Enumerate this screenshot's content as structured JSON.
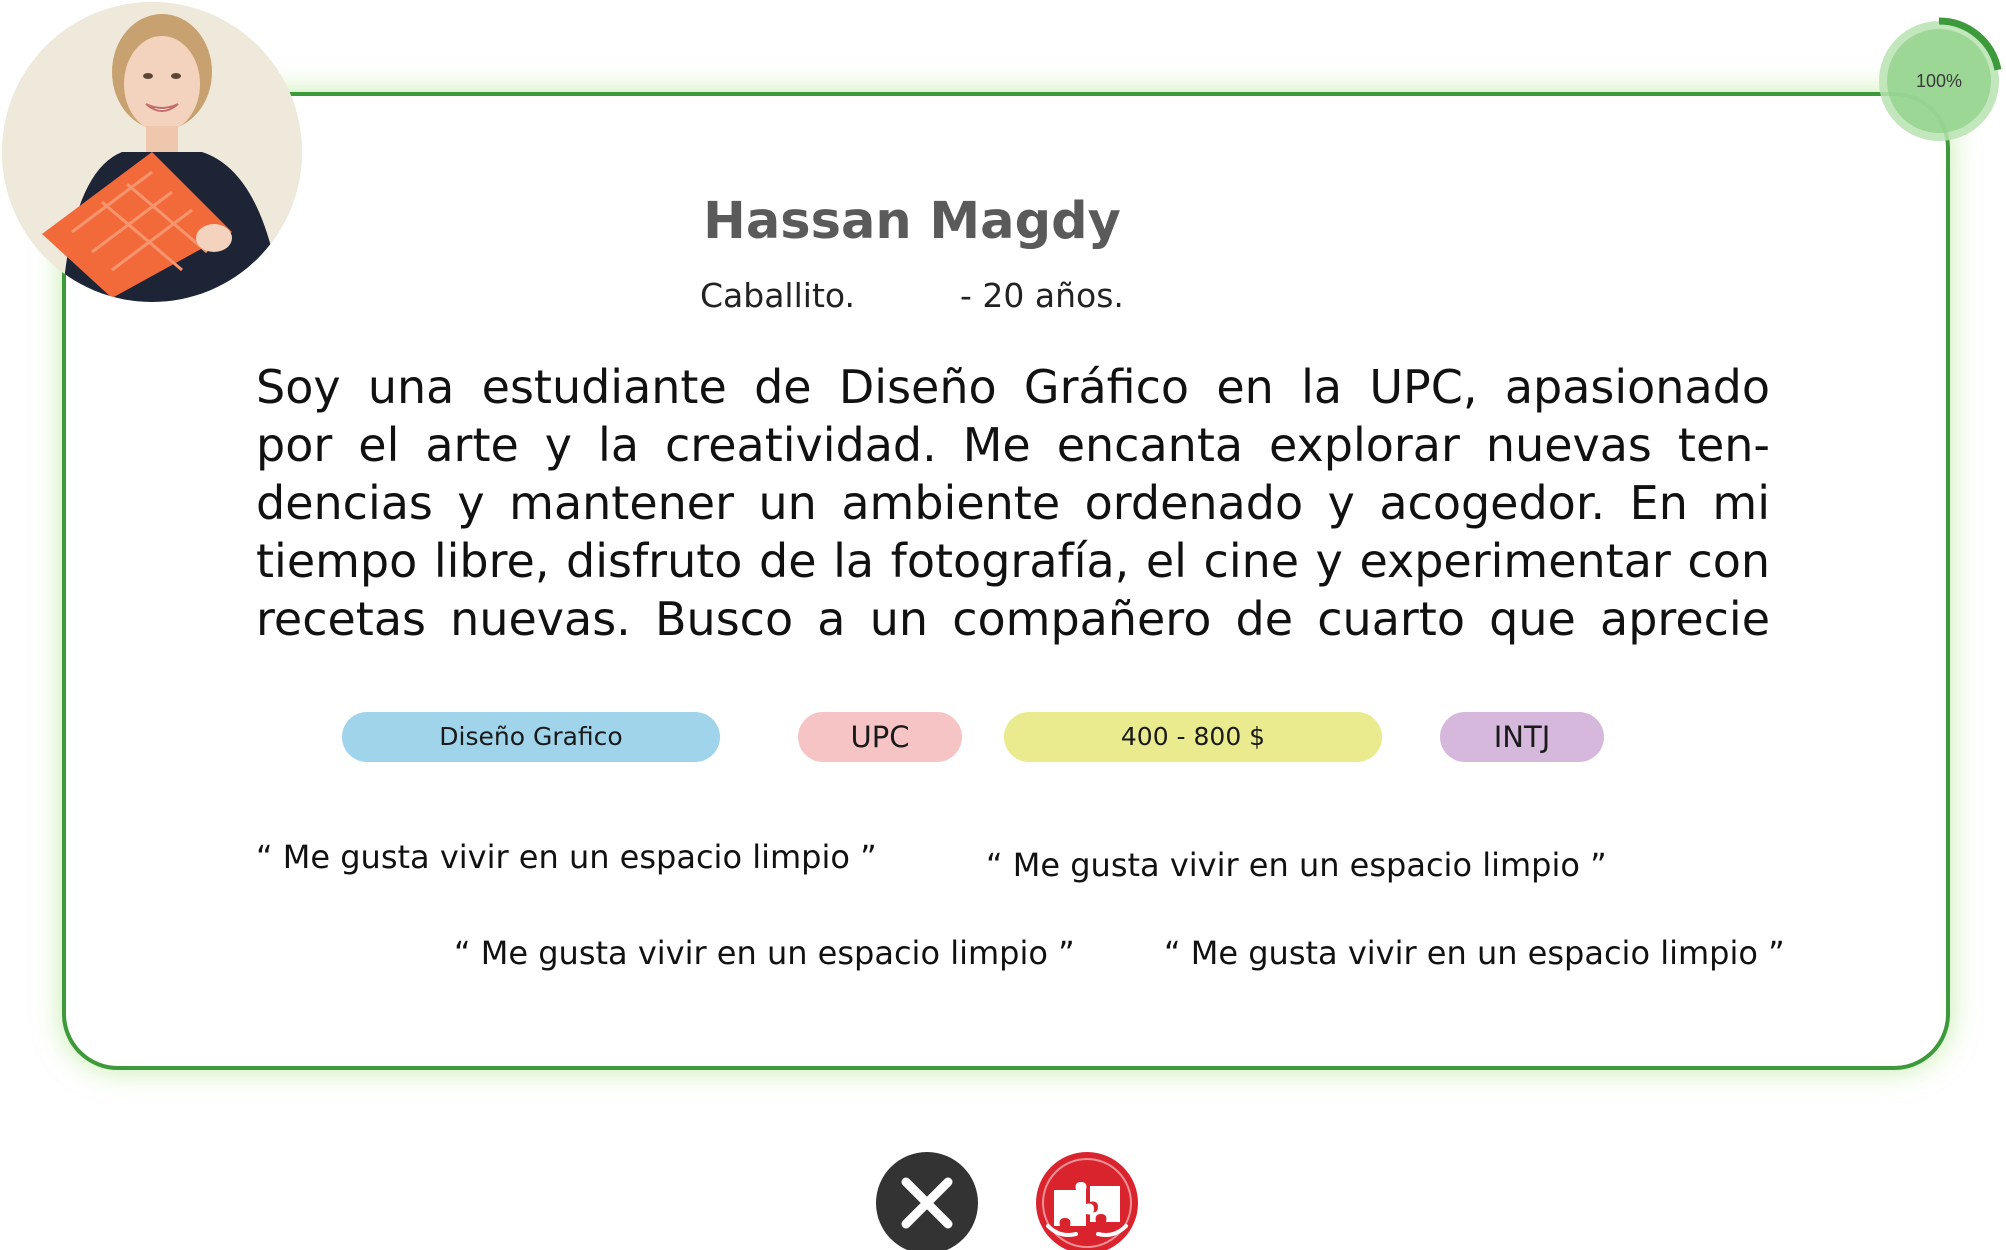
{
  "profile": {
    "name": "Hassan Magdy",
    "location": "Caballito.",
    "age": "- 20 años.",
    "avatar_icon": "person-photo",
    "bio_lines": [
      "Soy una estudiante de Diseño Gráfico en la UPC, apasionado",
      "por el arte y la creatividad. Me encanta explorar nuevas ten-",
      "dencias y mantener un ambiente ordenado y acogedor. En mi",
      "tiempo libre, disfruto de la fotografía, el cine y experimentar con",
      "recetas nuevas. Busco a un compañero de cuarto que aprecie"
    ]
  },
  "progress": {
    "label": "100%",
    "value": 1.0,
    "color": "#3d9a3a"
  },
  "tags": [
    {
      "label": "Diseño Grafico",
      "color": "#9fd4ea"
    },
    {
      "label": "UPC",
      "color": "#f6c4c4"
    },
    {
      "label": "400 - 800 $",
      "color": "#eaea8e"
    },
    {
      "label": "INTJ",
      "color": "#d6b8dc"
    }
  ],
  "quotes": [
    "“ Me gusta vivir en un espacio limpio ”",
    "“ Me gusta vivir en un espacio limpio ”",
    "“ Me gusta vivir en un espacio limpio ”",
    "“ Me gusta vivir en un espacio limpio ”"
  ],
  "actions": {
    "reject_icon": "close-icon",
    "match_icon": "puzzle-icon"
  },
  "colors": {
    "card_border": "#3d9a3a",
    "reject_button": "#333333",
    "match_button": "#d9242d"
  }
}
